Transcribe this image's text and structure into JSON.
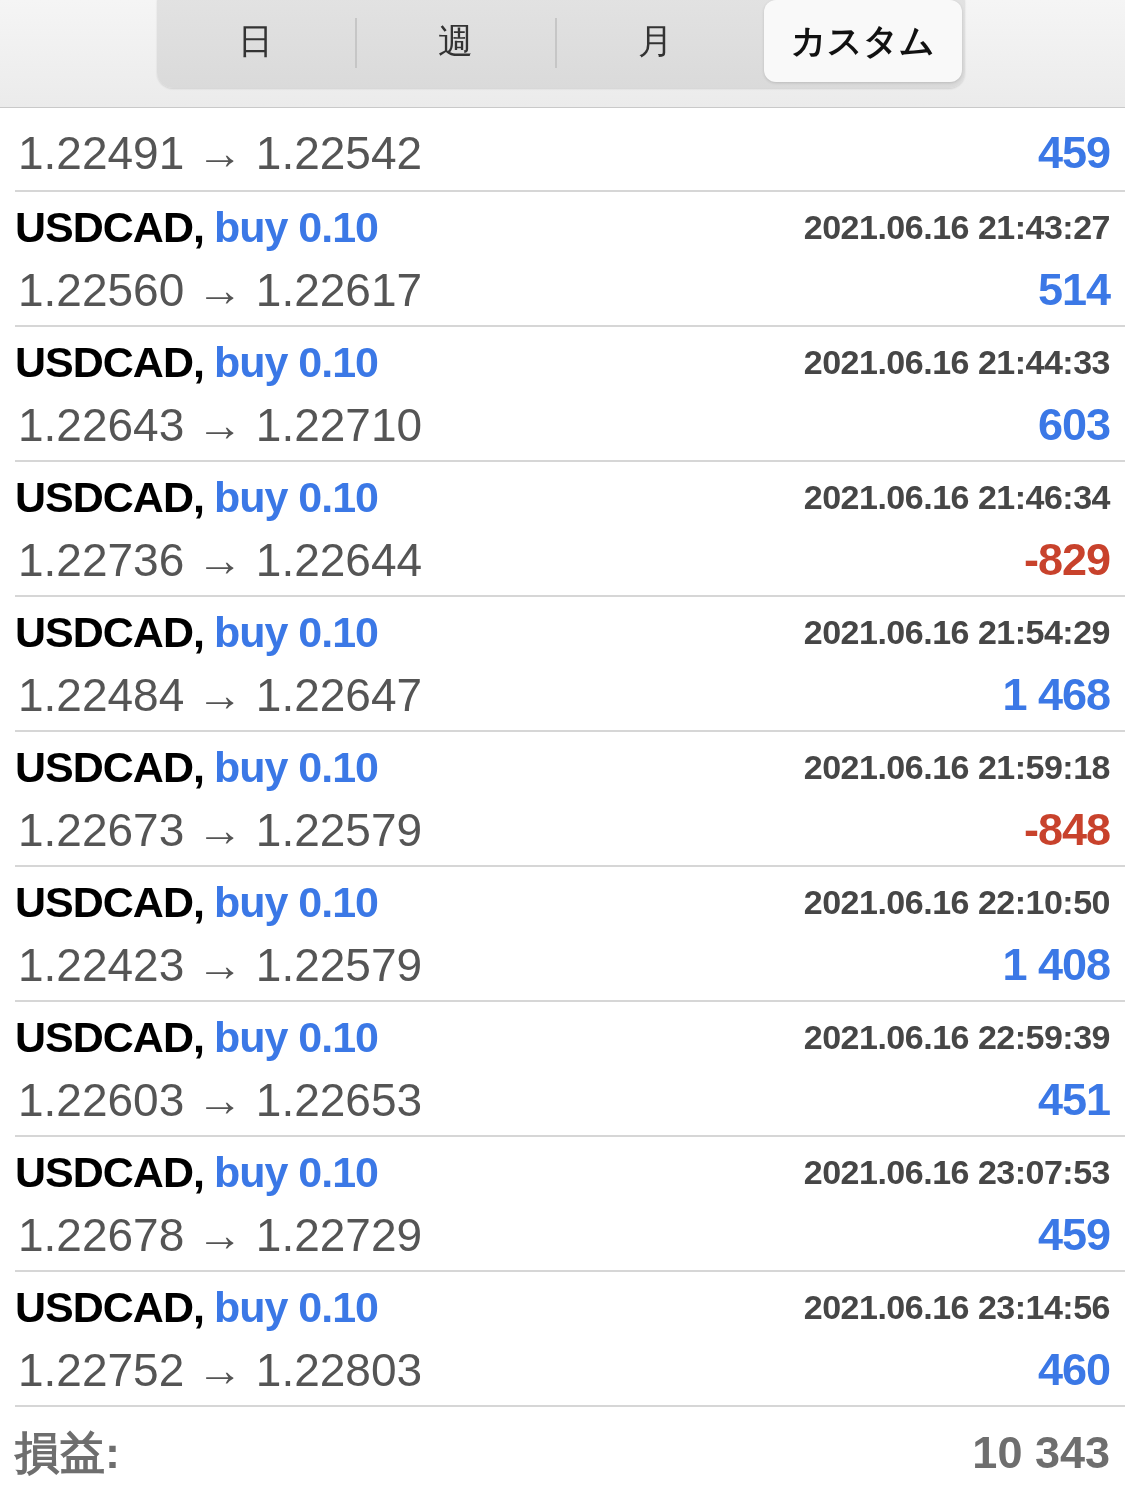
{
  "segments": [
    {
      "label": "日",
      "selected": false
    },
    {
      "label": "週",
      "selected": false
    },
    {
      "label": "月",
      "selected": false
    },
    {
      "label": "カスタム",
      "selected": true
    }
  ],
  "trades": [
    {
      "prices": "1.22491 → 1.22542",
      "profit": "459",
      "color": "#3b78e6"
    },
    {
      "symbol": "USDCAD,",
      "order": "buy 0.10",
      "time": "2021.06.16 21:43:27",
      "prices": "1.22560 → 1.22617",
      "profit": "514",
      "color": "#3b78e6"
    },
    {
      "symbol": "USDCAD,",
      "order": "buy 0.10",
      "time": "2021.06.16 21:44:33",
      "prices": "1.22643 → 1.22710",
      "profit": "603",
      "color": "#3b78e6"
    },
    {
      "symbol": "USDCAD,",
      "order": "buy 0.10",
      "time": "2021.06.16 21:46:34",
      "prices": "1.22736 → 1.22644",
      "profit": "-829",
      "color": "#c8422c"
    },
    {
      "symbol": "USDCAD,",
      "order": "buy 0.10",
      "time": "2021.06.16 21:54:29",
      "prices": "1.22484 → 1.22647",
      "profit": "1 468",
      "color": "#3b78e6"
    },
    {
      "symbol": "USDCAD,",
      "order": "buy 0.10",
      "time": "2021.06.16 21:59:18",
      "prices": "1.22673 → 1.22579",
      "profit": "-848",
      "color": "#c8422c"
    },
    {
      "symbol": "USDCAD,",
      "order": "buy 0.10",
      "time": "2021.06.16 22:10:50",
      "prices": "1.22423 → 1.22579",
      "profit": "1 408",
      "color": "#3b78e6"
    },
    {
      "symbol": "USDCAD,",
      "order": "buy 0.10",
      "time": "2021.06.16 22:59:39",
      "prices": "1.22603 → 1.22653",
      "profit": "451",
      "color": "#3b78e6"
    },
    {
      "symbol": "USDCAD,",
      "order": "buy 0.10",
      "time": "2021.06.16 23:07:53",
      "prices": "1.22678 → 1.22729",
      "profit": "459",
      "color": "#3b78e6"
    },
    {
      "symbol": "USDCAD,",
      "order": "buy 0.10",
      "time": "2021.06.16 23:14:56",
      "prices": "1.22752 → 1.22803",
      "profit": "460",
      "color": "#3b78e6"
    }
  ],
  "total": {
    "label": "損益:",
    "value": "10 343"
  }
}
